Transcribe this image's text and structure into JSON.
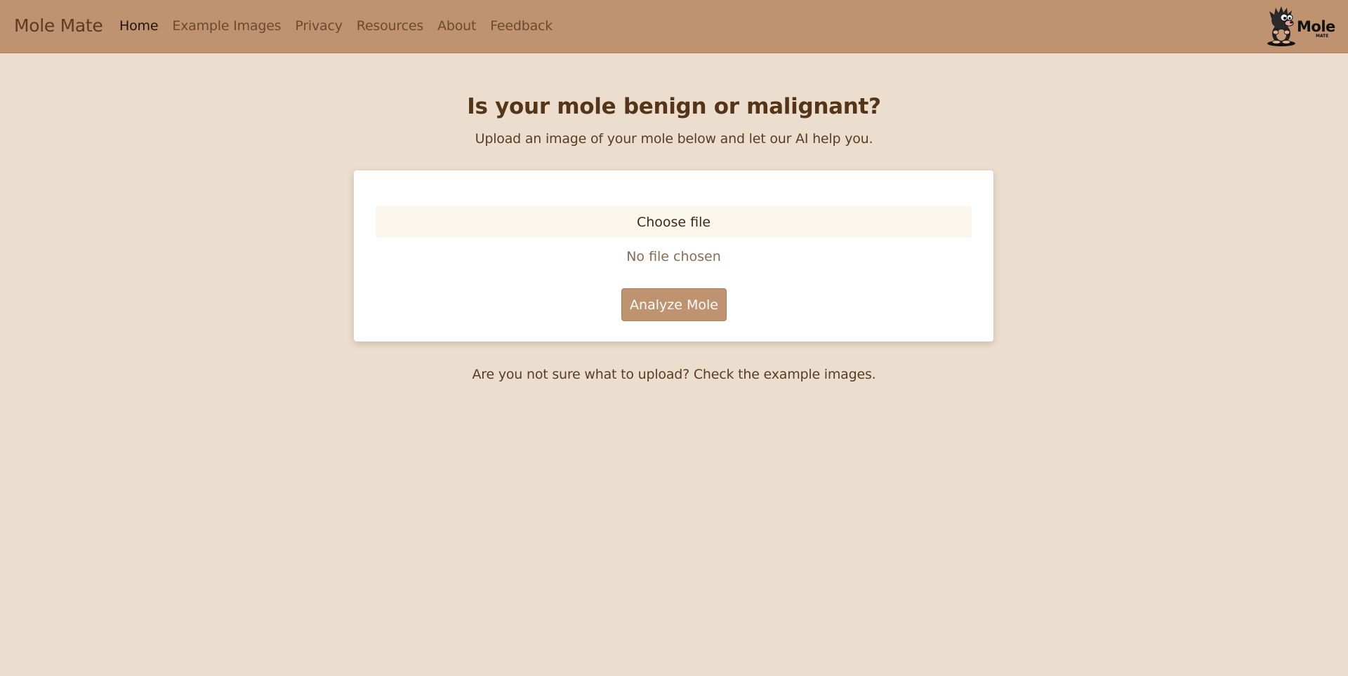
{
  "navbar": {
    "brand": "Mole Mate",
    "links": [
      {
        "label": "Home",
        "active": true
      },
      {
        "label": "Example Images",
        "active": false
      },
      {
        "label": "Privacy",
        "active": false
      },
      {
        "label": "Resources",
        "active": false
      },
      {
        "label": "About",
        "active": false
      },
      {
        "label": "Feedback",
        "active": false
      }
    ],
    "logo": {
      "text": "Mole",
      "subtext": "MATE",
      "icon": "mole-mascot-icon"
    }
  },
  "main": {
    "heading": "Is your mole benign or malignant?",
    "subheading": "Upload an image of your mole below and let our AI help you.",
    "upload": {
      "choose_label": "Choose file",
      "status": "No file chosen",
      "submit_label": "Analyze Mole"
    },
    "help_text": "Are you not sure what to upload? Check the example images."
  },
  "colors": {
    "navbar_bg": "#bf9270",
    "page_bg": "#ecdece",
    "accent": "#bf9270",
    "text": "#5b3c22"
  }
}
